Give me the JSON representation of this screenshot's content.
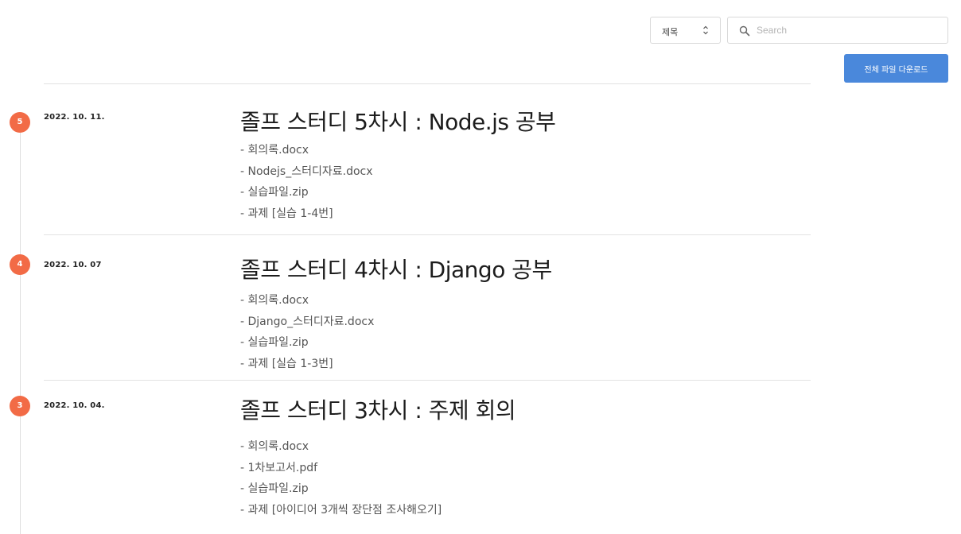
{
  "toolbar": {
    "filter_select": {
      "selected": "제목",
      "icon": "up-down-chevron-icon"
    },
    "search": {
      "placeholder": "Search",
      "value": "",
      "icon": "search-icon"
    },
    "download_all_label": "전체 파일 다운로드"
  },
  "colors": {
    "accent_button": "#4a88db",
    "badge": "#f26b46",
    "divider": "#e2e2e2"
  },
  "entries": [
    {
      "number": "5",
      "date": "2022. 10. 11.",
      "title": "졸프 스터디 5차시 : Node.js 공부",
      "files": [
        "- 회의록.docx",
        "- Nodejs_스터디자료.docx",
        "- 실습파일.zip",
        "- 과제 [실습 1-4번]"
      ]
    },
    {
      "number": "4",
      "date": "2022. 10. 07",
      "title": "졸프 스터디 4차시 : Django 공부",
      "files": [
        "- 회의록.docx",
        "- Django_스터디자료.docx",
        "- 실습파일.zip",
        "- 과제 [실습 1-3번]"
      ]
    },
    {
      "number": "3",
      "date": "2022. 10. 04.",
      "title": "졸프 스터디 3차시 : 주제 회의",
      "files": [
        "- 회의록.docx",
        "- 1차보고서.pdf",
        "- 실습파일.zip",
        "- 과제 [아이디어 3개씩 장단점 조사해오기]"
      ]
    }
  ]
}
